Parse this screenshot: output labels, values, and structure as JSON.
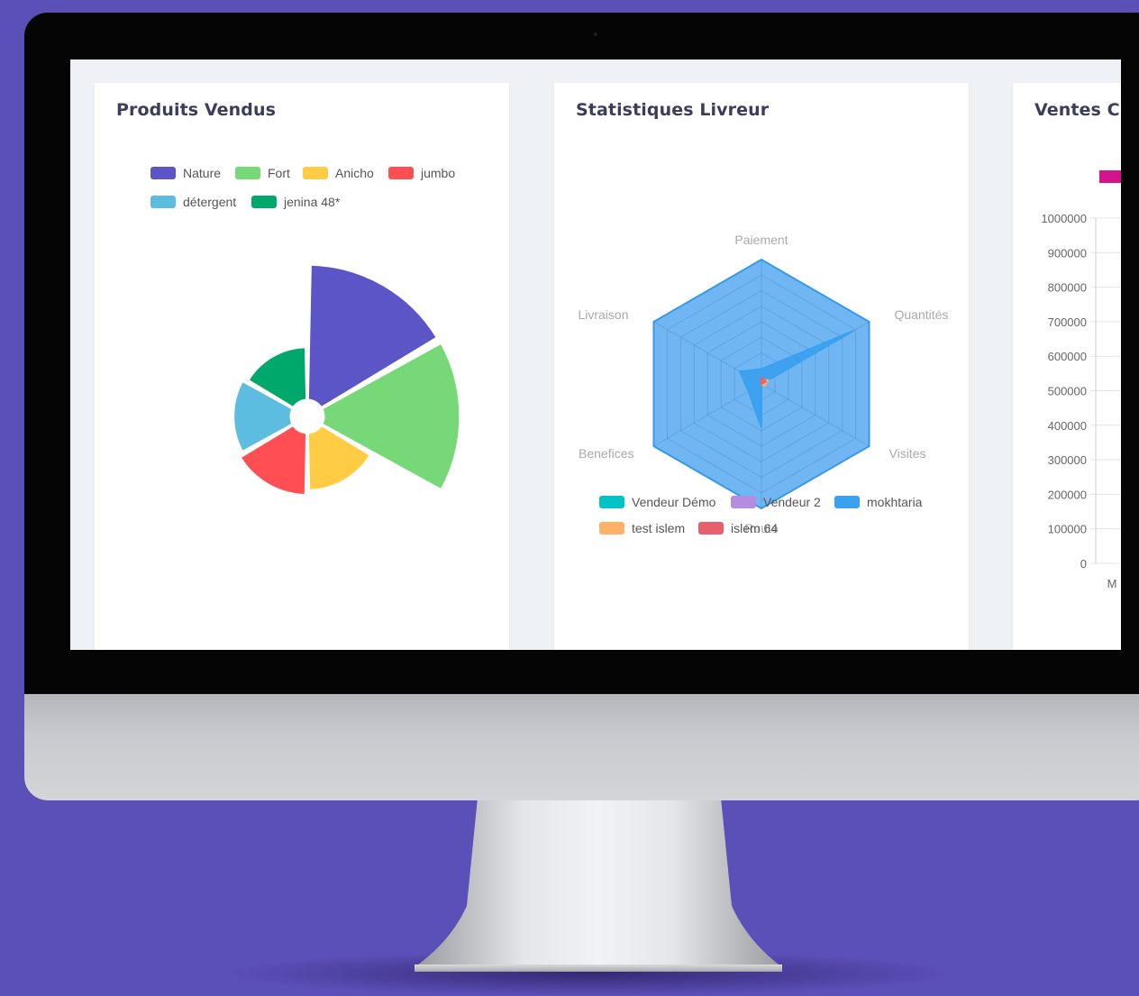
{
  "colors": {
    "background": "#5b4fb8",
    "screen_bg": "#eef1f5"
  },
  "cards": {
    "produits": {
      "title": "Produits Vendus"
    },
    "livreur": {
      "title": "Statistiques Livreur"
    },
    "ventes": {
      "title": "Ventes Cli"
    }
  },
  "chart_data": [
    {
      "type": "polarArea",
      "title": "Produits Vendus",
      "legend_placement": "top",
      "categories": [
        "Nature",
        "Fort",
        "Anicho",
        "jumbo",
        "détergent",
        "jenina 48*"
      ],
      "colors": [
        "#5b55c8",
        "#77d877",
        "#ffcc44",
        "#ff4f54",
        "#5dbde0",
        "#00a86b"
      ],
      "values": [
        164,
        165,
        80,
        85,
        80,
        75
      ]
    },
    {
      "type": "radar",
      "title": "Statistiques Livreur",
      "axes": [
        "Paiement",
        "Quantités",
        "Visites",
        "Route",
        "Benefices",
        "Livraison"
      ],
      "legend_placement": "bottom",
      "series": [
        {
          "name": "Vendeur Démo",
          "color": "#00c2c7",
          "values": [
            0.0,
            0.04,
            0.0,
            0.0,
            0.0,
            0.0
          ]
        },
        {
          "name": "Vendeur 2",
          "color": "#b48ce0",
          "values": [
            0.04,
            0.04,
            0.0,
            0.0,
            0.0,
            0.0
          ]
        },
        {
          "name": "mokhtaria",
          "color": "#3aa0f0",
          "values": [
            0.12,
            0.86,
            0.0,
            0.35,
            0.12,
            0.2
          ]
        },
        {
          "name": "test islem",
          "color": "#ffb266",
          "values": [
            0.03,
            0.06,
            0.03,
            0.0,
            0.0,
            0.0
          ]
        },
        {
          "name": "islem 64",
          "color": "#e8606d",
          "values": [
            0.05,
            0.04,
            0.0,
            0.0,
            0.0,
            0.0
          ]
        }
      ],
      "background_series": {
        "name": "",
        "color": "#3aa0f0",
        "values": [
          1,
          1,
          1,
          1,
          1,
          1
        ]
      }
    },
    {
      "type": "bar",
      "title": "Ventes Cli",
      "ylim": [
        0,
        1000000
      ],
      "y_ticks": [
        "1000000",
        "900000",
        "800000",
        "700000",
        "600000",
        "500000",
        "400000",
        "300000",
        "200000",
        "100000",
        "0"
      ],
      "x_ticks": [
        "M"
      ],
      "legend_color": "#d0168a"
    }
  ]
}
